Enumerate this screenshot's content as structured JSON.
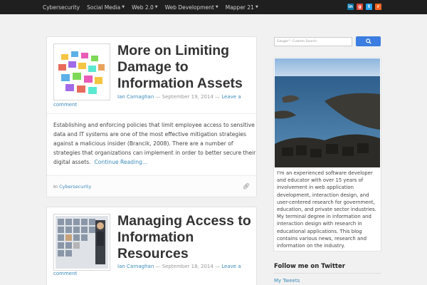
{
  "nav": {
    "items": [
      {
        "label": "Cybersecurity",
        "dropdown": false
      },
      {
        "label": "Social Media",
        "dropdown": true
      },
      {
        "label": "Web 2.0",
        "dropdown": true
      },
      {
        "label": "Web Development",
        "dropdown": true
      },
      {
        "label": "Mapper 21",
        "dropdown": true
      }
    ],
    "caret": "▼",
    "social": [
      {
        "name": "linkedin-icon",
        "glyph": "in",
        "color": "#0e76a8"
      },
      {
        "name": "google-plus-icon",
        "glyph": "g",
        "color": "#dd4b39"
      },
      {
        "name": "twitter-icon",
        "glyph": "t",
        "color": "#2aa3ef"
      },
      {
        "name": "rss-icon",
        "glyph": "r",
        "color": "#f26522"
      }
    ]
  },
  "posts": [
    {
      "title": "More on Limiting Damage to Information Assets",
      "author": "Ian Carnaghan",
      "sep": " — ",
      "date": "September 19, 2014",
      "leave": "Leave a",
      "comment": "comment",
      "excerpt": "Establishing and enforcing policies that limit employee access to sensitive data and IT systems are one of the most effective mitigation strategies against a malicious insider (Brancik, 2008).  There are a number of strategies that organizations can implement in order to better secure their digital assets.",
      "more": "Continue Reading…",
      "category_prefix": "In",
      "category": "Cybersecurity"
    },
    {
      "title": "Managing Access to Information Resources",
      "author": "Ian Carnaghan",
      "sep": " — ",
      "date": "September 18, 2014",
      "leave": "Leave a",
      "comment": "comment"
    }
  ],
  "sidebar": {
    "search_placeholder": "Google™ Custom Search",
    "search_button_icon": "search-icon",
    "bio": "I'm an experienced software developer and educator with over 15 years of involvement in web application development, interaction design, and user-centered research for government, education, and private sector industries. My terminal degree in information and interaction design with research in educational applications. This blog contains various news, research and information on the industry.",
    "twitter_title": "Follow me on Twitter",
    "tweets_link": "My Tweets"
  }
}
